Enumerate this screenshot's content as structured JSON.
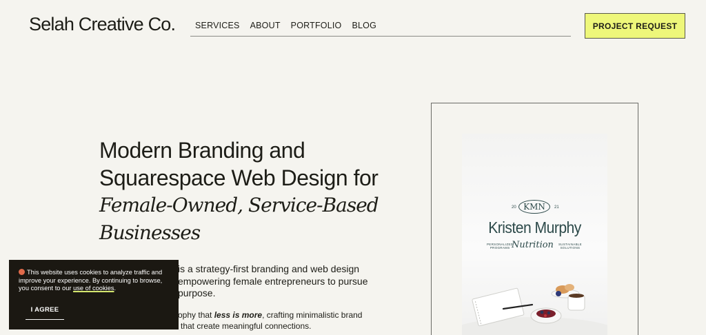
{
  "header": {
    "logo": "Selah Creative Co.",
    "nav": [
      "SERVICES",
      "ABOUT",
      "PORTFOLIO",
      "BLOG"
    ],
    "cta": "PROJECT REQUEST"
  },
  "hero": {
    "line1": "Modern Branding and",
    "line2": "Squarespace Web Design for",
    "italic1": "Female-Owned, Service-Based",
    "italic2": "Businesses",
    "body_p1_visible": "is a strategy-first branding and web design",
    "body_p1_line2": "empowering female entrepreneurs to pursue",
    "body_p1_line3": "purpose.",
    "body_p2_start": "ophy that ",
    "body_p2_emph": "less is more",
    "body_p2_rest": ", crafting minimalistic brand",
    "body_p2_line2": "that create meaningful connections."
  },
  "portfolio_card": {
    "monogram": "KMN",
    "year_left": "20",
    "year_right": "21",
    "name": "Kristen Murphy",
    "script": "Nutrition",
    "tag_left": "PERSONALIZED\nPROGRAMS",
    "tag_right": "SUSTAINABLE\nSOLUTIONS"
  },
  "cookie_banner": {
    "icon": "cookie-icon",
    "message": "This website uses cookies to analyze traffic and improve your experience. By continuing to browse, you consent to our ",
    "link": "use of cookies",
    "period": ".",
    "agree": "I AGREE"
  },
  "colors": {
    "background": "#f5f4ef",
    "cta_bg": "#eef77a",
    "cookie_bg": "#1b1812",
    "brand_teal": "#2d4a4a"
  }
}
